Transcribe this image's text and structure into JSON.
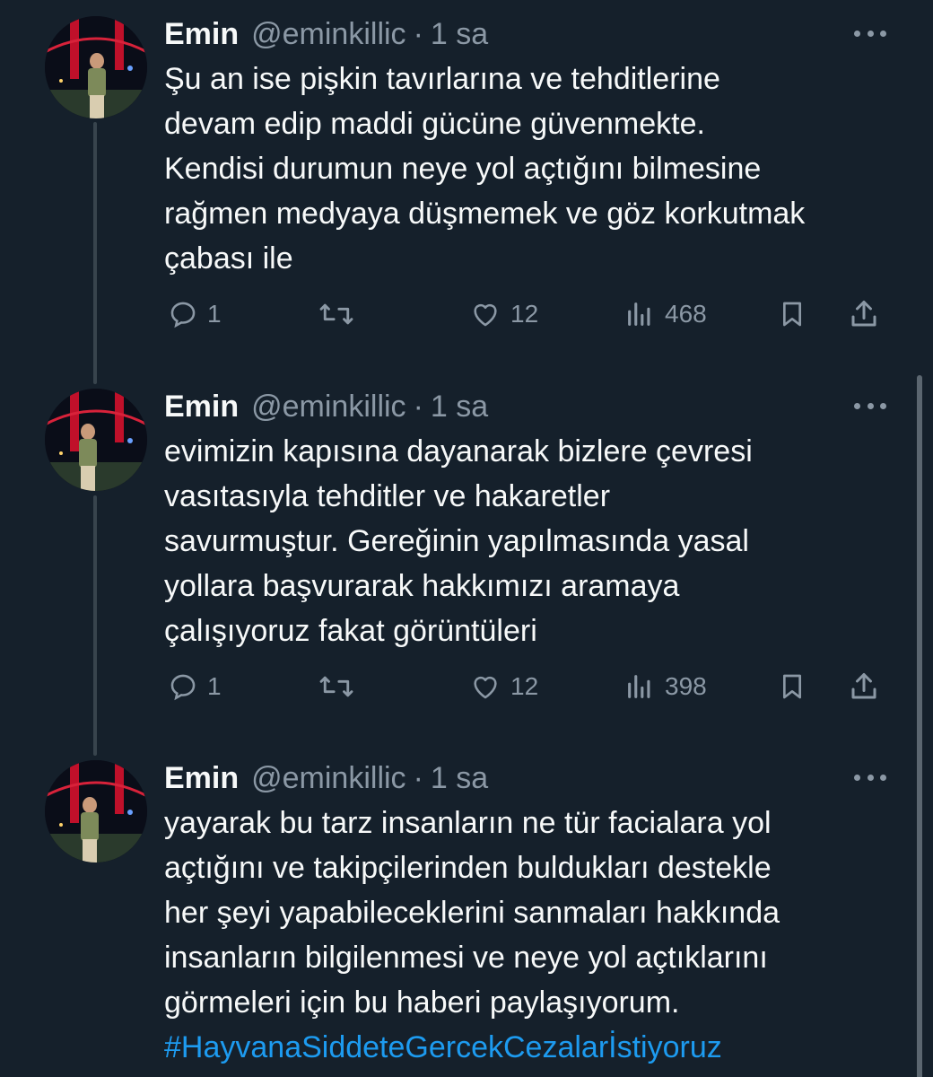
{
  "tweets": [
    {
      "name": "Emin",
      "handle": "@eminkillic",
      "separator": "·",
      "time": "1 sa",
      "lines": [
        "Şu an ise pişkin tavırlarına ve tehditlerine",
        "devam edip maddi gücüne güvenmekte.",
        "Kendisi durumun neye yol açtığını bilmesine",
        "rağmen medyaya düşmemek ve göz korkutmak",
        "çabası ile"
      ],
      "replies": "1",
      "likes": "12",
      "views": "468"
    },
    {
      "name": "Emin",
      "handle": "@eminkillic",
      "separator": "·",
      "time": "1 sa",
      "lines": [
        "evimizin kapısına dayanarak bizlere çevresi",
        "vasıtasıyla tehditler ve hakaretler",
        "savurmuştur. Gereğinin yapılmasında yasal",
        "yollara başvurarak hakkımızı aramaya",
        "çalışıyoruz fakat görüntüleri"
      ],
      "replies": "1",
      "likes": "12",
      "views": "398"
    },
    {
      "name": "Emin",
      "handle": "@eminkillic",
      "separator": "·",
      "time": "1 sa",
      "lines": [
        "yayarak bu tarz insanların ne tür facialara yol",
        "açtığını ve takipçilerinden buldukları destekle",
        "her şeyi yapabileceklerini sanmaları hakkında",
        "insanların bilgilenmesi ve neye yol açtıklarını",
        "görmeleri için bu haberi paylaşıyorum."
      ],
      "hashtag": "#HayvanaSiddeteGercekCezalarİstiyoruz"
    }
  ],
  "icons": {
    "reply": "reply-icon",
    "retweet": "retweet-icon",
    "like": "like-icon",
    "views": "views-icon",
    "bookmark": "bookmark-icon",
    "share": "share-icon",
    "more": "more-icon"
  },
  "colors": {
    "background": "#15202b",
    "text": "#f7f9f9",
    "secondary": "#8b98a5",
    "link": "#1d9bf0",
    "thread_line": "#38444d"
  }
}
